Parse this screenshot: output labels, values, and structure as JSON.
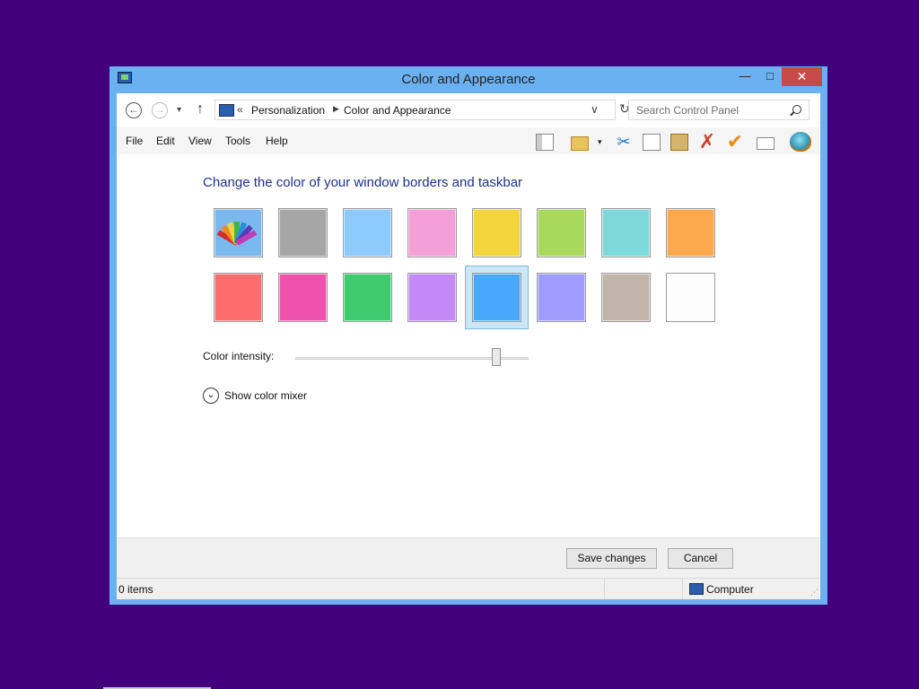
{
  "window": {
    "title": "Color and Appearance",
    "minimize_glyph": "—",
    "maximize_glyph": "□",
    "close_glyph": "✕"
  },
  "nav": {
    "back_glyph": "←",
    "forward_glyph": "→",
    "dropdown_glyph": "▾",
    "up_glyph": "↑",
    "address_prefix": "«",
    "breadcrumbs": [
      "Personalization",
      "Color and Appearance"
    ],
    "crumb_separator": "▶",
    "address_chevron": "∨",
    "refresh_glyph": "↻",
    "search_placeholder": "Search Control Panel"
  },
  "menu": {
    "items": [
      "File",
      "Edit",
      "View",
      "Tools",
      "Help"
    ]
  },
  "toolbar": {
    "icons": [
      "layout-icon",
      "folder-icon",
      "cut-icon",
      "copy-icon",
      "paste-icon",
      "delete-icon",
      "check-icon",
      "properties-icon",
      "shell-icon"
    ],
    "cut_glyph": "✂",
    "delete_glyph": "✗",
    "check_glyph": "✔",
    "folder_drop_glyph": "▾"
  },
  "main": {
    "heading": "Change the color of your window borders and taskbar",
    "swatches_row1": [
      "auto",
      "#a6a6a6",
      "#8ccbfc",
      "#f49fd8",
      "#f2d43d",
      "#a9d95c",
      "#7dd9d9",
      "#fca94d"
    ],
    "swatches_row2": [
      "#fd6d6d",
      "#ef52ac",
      "#3ecb6d",
      "#c589f7",
      "#4aa8fb",
      "#9f9cfe",
      "#c1b5a9",
      "#fdfdfd"
    ],
    "selected_swatch": 12,
    "intensity_label": "Color intensity:",
    "intensity_value": 0.86,
    "mixer_toggle_glyph": "⌄",
    "mixer_label": "Show color mixer"
  },
  "buttons": {
    "save": "Save changes",
    "cancel": "Cancel"
  },
  "status": {
    "items": "0 items",
    "location": "Computer",
    "grip_glyph": "⋰"
  }
}
